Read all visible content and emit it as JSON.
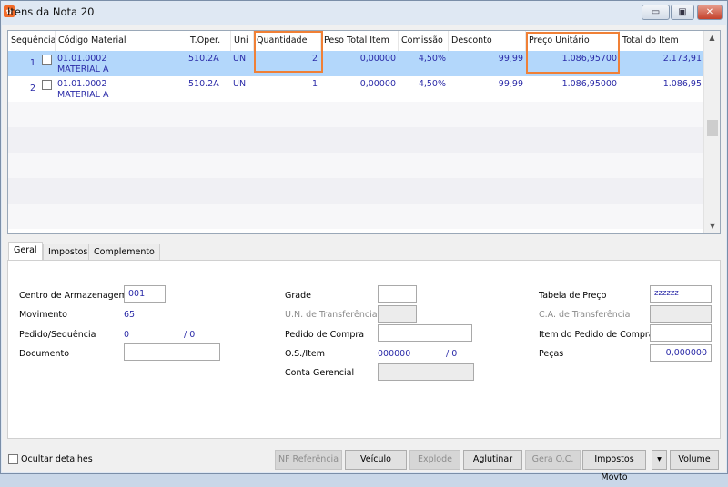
{
  "window": {
    "title": "Itens da Nota 20",
    "minimize": "▭",
    "maximize": "▣",
    "close": "✕"
  },
  "grid": {
    "columns": [
      "Sequência",
      "Código Material",
      "T.Oper.",
      "Uni",
      "Quantidade",
      "Peso Total Item",
      "Comissão",
      "Desconto",
      "Preço Unitário",
      "Total do Item"
    ],
    "rows": [
      {
        "seq": "1",
        "codigo": "01.01.0002",
        "material": "MATERIAL A",
        "toper": "510.2A",
        "uni": "UN",
        "quantidade": "2",
        "peso": "0,00000",
        "comissao": "4,50%",
        "desconto": "99,99",
        "preco": "1.086,95700",
        "total": "2.173,91",
        "selected": true
      },
      {
        "seq": "2",
        "codigo": "01.01.0002",
        "material": "MATERIAL A",
        "toper": "510.2A",
        "uni": "UN",
        "quantidade": "1",
        "peso": "0,00000",
        "comissao": "4,50%",
        "desconto": "99,99",
        "preco": "1.086,95000",
        "total": "1.086,95",
        "selected": false
      }
    ],
    "selection_color": "#b3d7fb",
    "highlight_color": "#f08036"
  },
  "tabs": [
    "Geral",
    "Impostos",
    "Complemento"
  ],
  "form": {
    "centro_label": "Centro de Armazenagem",
    "centro_value": "001",
    "movimento_label": "Movimento",
    "movimento_value": "65",
    "pedido_seq_label": "Pedido/Sequência",
    "pedido_value": "0",
    "sequencia_value": "/ 0",
    "documento_label": "Documento",
    "documento_value": "",
    "grade_label": "Grade",
    "un_transf_label": "U.N. de Transferência",
    "pedido_compra_label": "Pedido de Compra",
    "os_item_label": "O.S./Item",
    "os_value": "000000",
    "item_value": "/ 0",
    "conta_label": "Conta Gerencial",
    "tabela_label": "Tabela de Preço",
    "tabela_value": "zzzzzz",
    "ca_transf_label": "C.A. de Transferência",
    "item_pedido_label": "Item do Pedido de Compra",
    "pecas_label": "Peças",
    "pecas_value": "0,000000"
  },
  "footer": {
    "ocultar_label": "Ocultar detalhes",
    "buttons": [
      "NF Referência",
      "Veículo",
      "Explode",
      "Aglutinar",
      "Gera O.C.",
      "Impostos Movto",
      "▾",
      "Volume"
    ]
  }
}
